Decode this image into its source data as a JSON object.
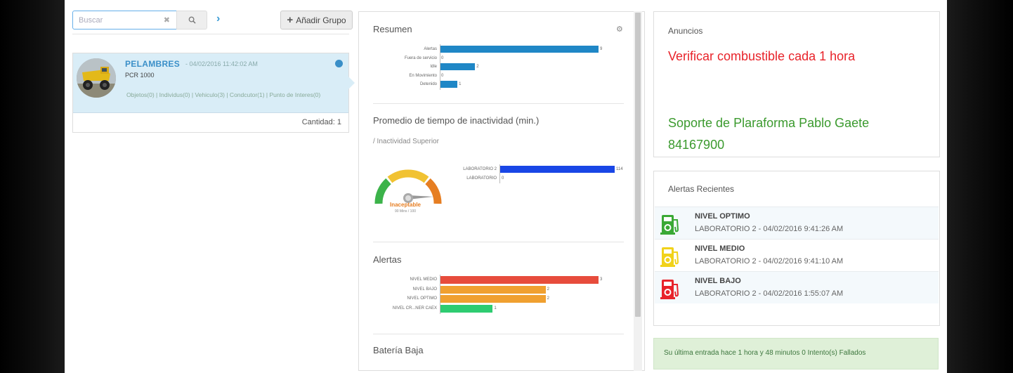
{
  "search": {
    "placeholder": "Buscar",
    "clear_icon": "clear-x-icon",
    "search_icon": "magnifier-icon"
  },
  "toolbar": {
    "add_group_label": "Añadir Grupo"
  },
  "group": {
    "name": "PELAMBRES",
    "date": "- 04/02/2016 11:42:02 AM",
    "model": "PCR 1000",
    "links_line": "Objetos(0) | Individus(0) | Vehiculo(3) | Condcutor(1) | Punto de Interes(0)",
    "quantity": "Cantidad: 1"
  },
  "resumen": {
    "title": "Resumen",
    "chart_data": {
      "type": "bar",
      "categories": [
        "Alertas",
        "Fuera de servicio",
        "Idle",
        "En Movimiento",
        "Detenido"
      ],
      "values": [
        9,
        0,
        2,
        0,
        1
      ],
      "xlim": [
        0,
        9
      ]
    }
  },
  "promedio": {
    "title": "Promedio de tiempo de inactividad (min.)",
    "subtitle": "/ Inactividad Superior",
    "gauge_label": "Inaceptable",
    "gauge_sub": "90 Mins / 100",
    "chart_data": {
      "type": "bar",
      "categories": [
        "LABORATORIO 2",
        "LABORATORIO"
      ],
      "values": [
        114,
        0
      ],
      "xlim": [
        0,
        114
      ]
    }
  },
  "alertas": {
    "title": "Alertas",
    "chart_data": {
      "type": "bar",
      "categories": [
        "NIVEL MEDIO",
        "NIVEL BAJO",
        "NIVEL OPTIMO",
        "NIVEL CR...NER CAEX"
      ],
      "values": [
        3,
        2,
        2,
        1
      ],
      "colors": [
        "#e74c3c",
        "#f0a030",
        "#f0a030",
        "#2ecc71"
      ],
      "xlim": [
        0,
        3
      ]
    }
  },
  "bateria": {
    "title": "Batería Baja"
  },
  "anuncios": {
    "title": "Anuncios",
    "message_red": "Verificar combustible cada 1 hora",
    "message_green": "Soporte de Plaraforma    Pablo Gaete 84167900"
  },
  "recientes": {
    "title": "Alertas Recientes",
    "items": [
      {
        "name": "NIVEL OPTIMO",
        "detail": "LABORATORIO 2 - 04/02/2016 9:41:26 AM",
        "color": "#3aa935"
      },
      {
        "name": "NIVEL MEDIO",
        "detail": "LABORATORIO 2 - 04/02/2016 9:41:10 AM",
        "color": "#f1d21a"
      },
      {
        "name": "NIVEL BAJO",
        "detail": "LABORATORIO 2 - 04/02/2016 1:55:07 AM",
        "color": "#e8232a"
      }
    ]
  },
  "status": {
    "login_text": "Su última entrada hace 1 hora y 48 minutos 0 Intento(s) Fallados"
  }
}
